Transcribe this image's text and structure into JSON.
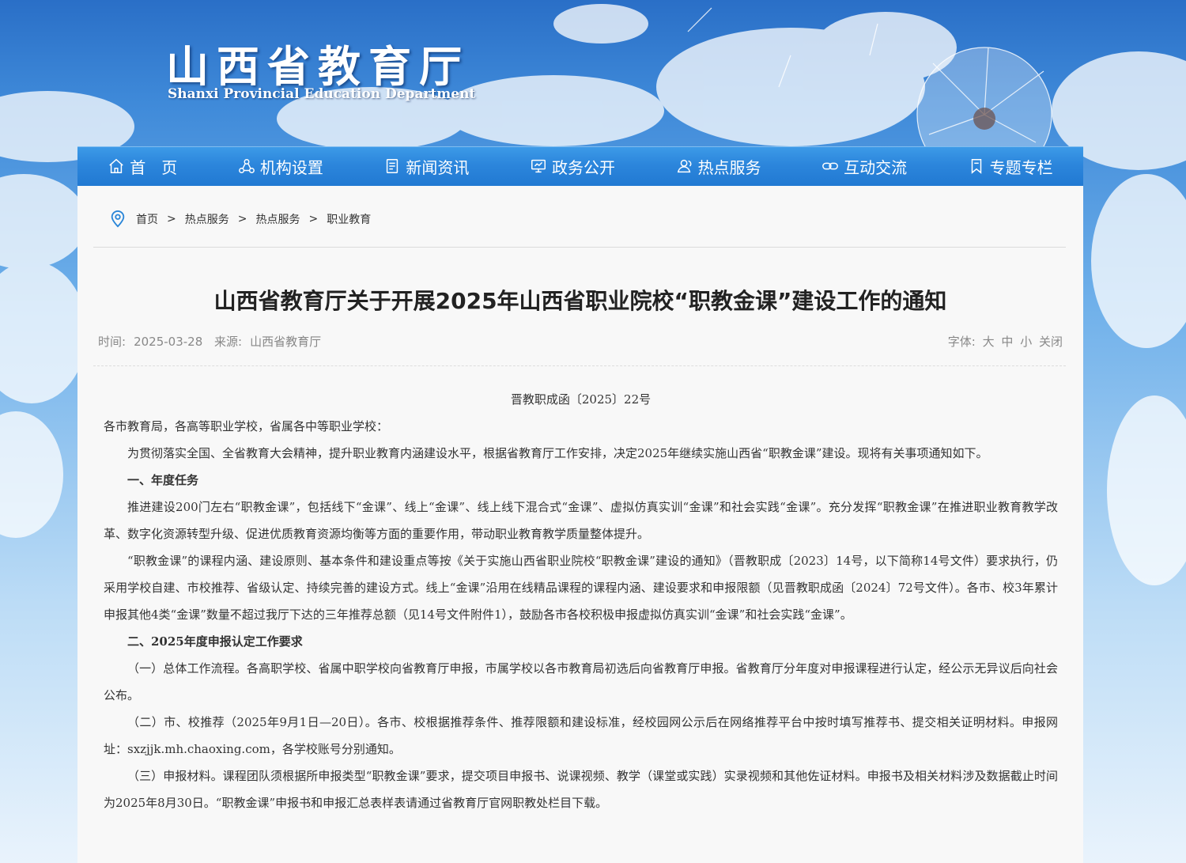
{
  "header": {
    "logo_cn": "山西省教育厅",
    "logo_en": "Shanxi Provincial Education Department"
  },
  "nav": {
    "items": [
      {
        "label": "首　页",
        "icon": "home-icon"
      },
      {
        "label": "机构设置",
        "icon": "org-icon"
      },
      {
        "label": "新闻资讯",
        "icon": "news-icon"
      },
      {
        "label": "政务公开",
        "icon": "monitor-icon"
      },
      {
        "label": "热点服务",
        "icon": "user-service-icon"
      },
      {
        "label": "互动交流",
        "icon": "link-icon"
      },
      {
        "label": "专题专栏",
        "icon": "bookmark-icon"
      }
    ]
  },
  "breadcrumb": {
    "icon": "location-icon",
    "items": [
      "首页",
      "热点服务",
      "热点服务",
      "职业教育"
    ],
    "separator": ">"
  },
  "article": {
    "title": "山西省教育厅关于开展2025年山西省职业院校“职教金课”建设工作的通知",
    "time_label": "时间:",
    "time": "2025-03-28",
    "source_label": "来源:",
    "source": "山西省教育厅",
    "font_label": "字体:",
    "font_large": "大",
    "font_medium": "中",
    "font_small": "小",
    "close": "关闭",
    "doc_number": "晋教职成函〔2025〕22号",
    "salutation": "各市教育局，各高等职业学校，省属各中等职业学校：",
    "para_intro": "为贯彻落实全国、全省教育大会精神，提升职业教育内涵建设水平，根据省教育厅工作安排，决定2025年继续实施山西省“职教金课”建设。现将有关事项通知如下。",
    "heading_1": "一、年度任务",
    "para_1a": "推进建设200门左右“职教金课”，包括线下“金课”、线上“金课”、线上线下混合式“金课”、虚拟仿真实训“金课”和社会实践“金课”。充分发挥“职教金课”在推进职业教育教学改革、数字化资源转型升级、促进优质教育资源均衡等方面的重要作用，带动职业教育教学质量整体提升。",
    "para_1b": "“职教金课”的课程内涵、建设原则、基本条件和建设重点等按《关于实施山西省职业院校“职教金课”建设的通知》（晋教职成〔2023〕14号，以下简称14号文件）要求执行，仍采用学校自建、市校推荐、省级认定、持续完善的建设方式。线上“金课”沿用在线精品课程的课程内涵、建设要求和申报限额（见晋教职成函〔2024〕72号文件）。各市、校3年累计申报其他4类“金课”数量不超过我厅下达的三年推荐总额（见14号文件附件1），鼓励各市各校积极申报虚拟仿真实训“金课”和社会实践“金课”。",
    "heading_2": "二、2025年度申报认定工作要求",
    "para_2a": "（一）总体工作流程。各高职学校、省属中职学校向省教育厅申报，市属学校以各市教育局初选后向省教育厅申报。省教育厅分年度对申报课程进行认定，经公示无异议后向社会公布。",
    "para_2b": "（二）市、校推荐（2025年9月1日—20日）。各市、校根据推荐条件、推荐限额和建设标准，经校园网公示后在网络推荐平台中按时填写推荐书、提交相关证明材料。申报网址：sxzjjk.mh.chaoxing.com，各学校账号分别通知。",
    "para_2c": "（三）申报材料。课程团队须根据所申报类型“职教金课”要求，提交项目申报书、说课视频、教学（课堂或实践）实录视频和其他佐证材料。申报书及相关材料涉及数据截止时间为2025年8月30日。“职教金课”申报书和申报汇总表样表请通过省教育厅官网职教处栏目下载。"
  }
}
